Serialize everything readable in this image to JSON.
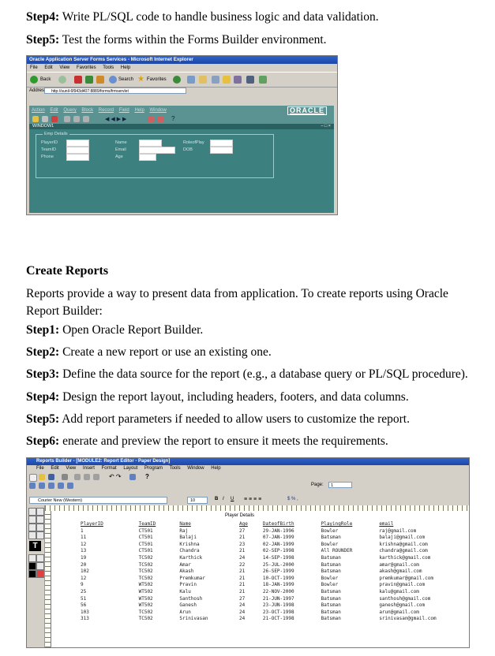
{
  "doc": {
    "step4_forms": {
      "label": "Step4:",
      "text": " Write PL/SQL code to handle business logic and data validation."
    },
    "step5_forms": {
      "label": "Step5:",
      "text": " Test the forms within the Forms Builder environment."
    },
    "section_heading": "Create Reports",
    "intro": "Reports provide a way to present data from application. To create reports using Oracle Report Builder:",
    "steps": [
      {
        "label": "Step1:",
        "text": " Open Oracle Report Builder."
      },
      {
        "label": "Step2:",
        "text": " Create a new report or use an existing one."
      },
      {
        "label": "Step3:",
        "text": " Define the data source for the report (e.g., a database query or PL/SQL procedure)."
      },
      {
        "label": "Step4:",
        "text": " Design the report layout, including headers, footers, and data columns."
      },
      {
        "label": "Step5:",
        "text": " Add report parameters if needed to allow users to customize the report."
      },
      {
        "label": "Step6:",
        "text": " enerate and preview the report to ensure it meets the requirements."
      }
    ]
  },
  "forms_screenshot": {
    "window_title": "Oracle Application Server Forms Services - Microsoft Internet Explorer",
    "browser_menu": [
      "File",
      "Edit",
      "View",
      "Favorites",
      "Tools",
      "Help"
    ],
    "back_label": "Back",
    "search_label": "Search",
    "favorites_label": "Favorites",
    "address_label": "Address",
    "address_url": "http://sunil-6f943d407:8889/forms/frmservlet",
    "forms_menu": [
      "Action",
      "Edit",
      "Query",
      "Block",
      "Record",
      "Field",
      "Help",
      "Window"
    ],
    "logo": "ORACLE",
    "window_name": "WINDOW1",
    "window_controls": "− □ ×",
    "block_title": "Emp Details",
    "fields": {
      "player_id": "PlayerID",
      "team_id": "TeamID",
      "phone": "Phone",
      "name": "Name",
      "email": "Email",
      "age": "Age",
      "role": "RoleofPlay",
      "dob": "DOB"
    }
  },
  "reports_screenshot": {
    "window_title": "Reports Builder - [MODULE2: Report Editor - Paper Design]",
    "menu": [
      "File",
      "Edit",
      "View",
      "Insert",
      "Format",
      "Layout",
      "Program",
      "Tools",
      "Window",
      "Help"
    ],
    "font_name": "Courier New (Western)",
    "font_size": "10",
    "page_label": "Page:",
    "page_value": "1",
    "report_title": "Player Details",
    "columns": [
      "PlayerID",
      "TeamID",
      "Name",
      "Age",
      "DateofBirth",
      "PlayingRole",
      "email"
    ],
    "rows": [
      [
        "1",
        "CT501",
        "Raj",
        "27",
        "29-JAN-1996",
        "Bowler",
        "raj@gmail.com"
      ],
      [
        "11",
        "CT501",
        "Balaji",
        "21",
        "07-JAN-1999",
        "Batsman",
        "balaji@gmail.com"
      ],
      [
        "12",
        "CT501",
        "Krishna",
        "23",
        "02-JAN-1999",
        "Bowler",
        "krishna@gmail.com"
      ],
      [
        "13",
        "CT501",
        "Chandra",
        "21",
        "02-SEP-1998",
        "All ROUNDER",
        "chandra@gmail.com"
      ],
      [
        "19",
        "TC502",
        "Karthick",
        "24",
        "14-SEP-1998",
        "Batsman",
        "karthick@gmail.com"
      ],
      [
        "20",
        "TC502",
        "Amar",
        "22",
        "25-JUL-2000",
        "Batsman",
        "amar@gmail.com"
      ],
      [
        "102",
        "TC502",
        "Akash",
        "21",
        "26-SEP-1999",
        "Batsman",
        "akash@gmail.com"
      ],
      [
        "12",
        "TC502",
        "Premkumar",
        "21",
        "10-OCT-1999",
        "Bowler",
        "premkumar@gmail.com"
      ],
      [
        "9",
        "WT502",
        "Pravin",
        "21",
        "18-JAN-1999",
        "Bowler",
        "pravin@gmail.com"
      ],
      [
        "25",
        "WT502",
        "Kalu",
        "21",
        "22-NOV-2000",
        "Batsman",
        "kalu@gmail.com"
      ],
      [
        "51",
        "WT502",
        "Santhosh",
        "27",
        "21-JUN-1997",
        "Batsman",
        "santhosh@gmail.com"
      ],
      [
        "56",
        "WT502",
        "Ganesh",
        "24",
        "23-JUN-1998",
        "Batsman",
        "ganesh@gmail.com"
      ],
      [
        "103",
        "TC502",
        "Arun",
        "24",
        "23-OCT-1998",
        "Batsman",
        "arun@gmail.com"
      ],
      [
        "313",
        "TC502",
        "Srinivasan",
        "24",
        "21-OCT-1998",
        "Batsman",
        "srinivasan@gmail.com"
      ]
    ]
  }
}
